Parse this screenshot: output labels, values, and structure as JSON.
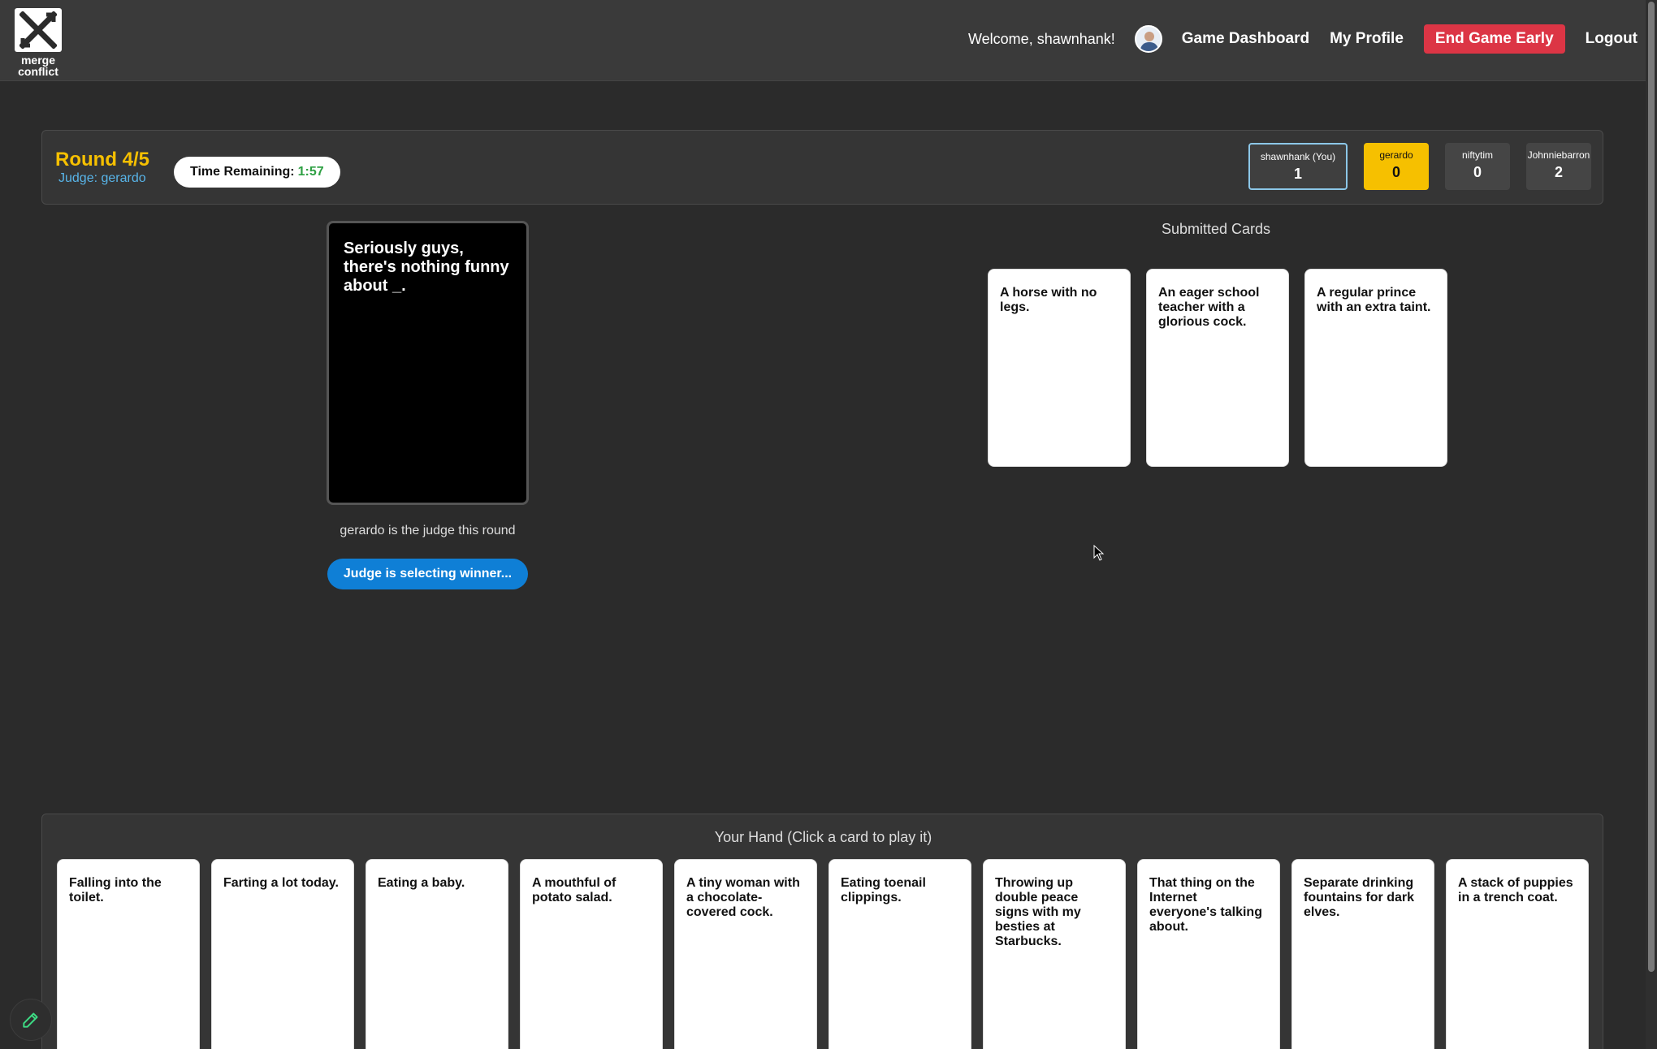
{
  "brand": {
    "logo_text_1": "merge",
    "logo_text_2": "conflict"
  },
  "nav": {
    "welcome": "Welcome, shawnhank!",
    "dashboard": "Game Dashboard",
    "profile": "My Profile",
    "end_game": "End Game Early",
    "logout": "Logout"
  },
  "round": {
    "title": "Round 4/5",
    "judge": "Judge: gerardo",
    "timer_label": "Time Remaining:",
    "timer_value": "1:57"
  },
  "players": [
    {
      "name": "shawnhank (You)",
      "score": "1"
    },
    {
      "name": "gerardo",
      "score": "0"
    },
    {
      "name": "niftytim",
      "score": "0"
    },
    {
      "name": "Johnniebarron",
      "score": "2"
    }
  ],
  "black_card": {
    "text": "Seriously guys, there's nothing funny about _."
  },
  "judge_note": "gerardo is the judge this round",
  "judge_button": "Judge is selecting winner...",
  "submitted": {
    "title": "Submitted Cards",
    "cards": [
      "A horse with no legs.",
      "An eager school teacher with a glorious cock.",
      "A regular prince with an extra taint."
    ]
  },
  "hand": {
    "title": "Your Hand (Click a card to play it)",
    "cards": [
      "Falling into the toilet.",
      "Farting a lot today.",
      "Eating a baby.",
      "A mouthful of potato salad.",
      "A tiny woman with a chocolate-covered cock.",
      "Eating toenail clippings.",
      "Throwing up double peace signs with my besties at Starbucks.",
      "That thing on the Internet everyone's talking about.",
      "Separate drinking fountains for dark elves.",
      "A stack of puppies in a trench coat."
    ]
  },
  "colors": {
    "accent_gold": "#f6c000",
    "danger": "#dc3545",
    "primary": "#0f7fd6",
    "timer_green": "#2ea043"
  },
  "icons": {
    "logo": "x-mark-icon",
    "edit": "pencil-icon",
    "cursor": "mouse-pointer-icon"
  }
}
